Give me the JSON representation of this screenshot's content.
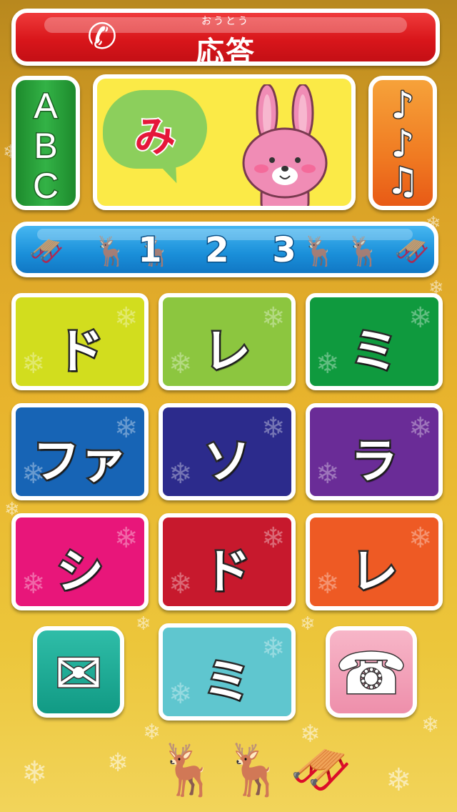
{
  "answer_button": {
    "label": "応答",
    "ruby": "おうとう",
    "icon": "phone-handset-icon"
  },
  "abc_button": {
    "letters": [
      "A",
      "B",
      "C"
    ]
  },
  "center_panel": {
    "bubble_char": "み",
    "character": "pink-rabbit"
  },
  "music_button": {
    "icons": [
      "music-note-icon",
      "music-note-icon",
      "double-music-note-icon"
    ]
  },
  "number_button": {
    "label": "1 2 3",
    "decoration": "reindeer-sleigh"
  },
  "keys": [
    {
      "label": "ド",
      "color": "#d2dd1e"
    },
    {
      "label": "レ",
      "color": "#8cc63f"
    },
    {
      "label": "ミ",
      "color": "#0f9a3e"
    },
    {
      "label": "ファ",
      "color": "#1764b5"
    },
    {
      "label": "ソ",
      "color": "#2c2b8c"
    },
    {
      "label": "ラ",
      "color": "#6a2c97"
    },
    {
      "label": "シ",
      "color": "#e8167a"
    },
    {
      "label": "ド",
      "color": "#c7192d"
    },
    {
      "label": "レ",
      "color": "#ee5a24"
    },
    {
      "label": "ミ",
      "color": "#5fc6cf"
    }
  ],
  "mail_button": {
    "icon": "envelope-icon"
  },
  "telephone_button": {
    "icon": "telephone-icon"
  },
  "colors": {
    "answer": "#d9161b",
    "abc": "#33b246",
    "music": "#f07b22",
    "number": "#1a8fd9",
    "panel": "#fbea47",
    "mail": "#119a84",
    "telephone": "#ee8fab"
  }
}
